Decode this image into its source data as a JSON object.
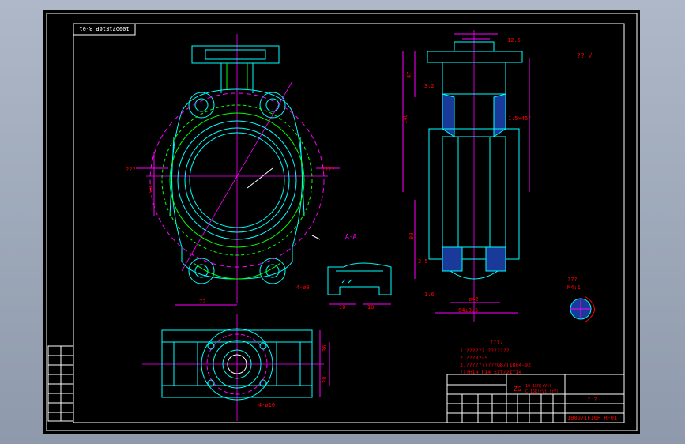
{
  "drawing_number_top": "100D71F16P R-01",
  "drawing_number_block": "100D71F16P R-01",
  "section_label": "A-A",
  "material": "ZG",
  "material_sub1": "10-15R(rVt)",
  "material_sub2": "C-15R(rVt)(rV)",
  "notes_title": "???:",
  "notes": [
    "1.?????? ???????",
    "2.???R2~5",
    "3.??????????GB/T1804-92",
    "  ???H14 h14 ±IT/2IT14"
  ],
  "title_marks": "?   ?",
  "roughness_label": "???",
  "roughness_value": "M4:1",
  "check_mark": "??  √",
  "dims": {
    "d72": "72",
    "d4m8": "4-ø8",
    "d90": "90",
    "d140": "140",
    "d47": "47",
    "d3_2": "3.2",
    "d12_5": "12.5",
    "d15x45": "1.5×45°",
    "d42": "ø42",
    "d64": "64±0.5",
    "d1_6": "1.6",
    "d10a": "10",
    "d10b": "10",
    "d36": "36",
    "d28": "28",
    "d4m10": "4-ø10",
    "d80": "80",
    "d3_5": "3.5",
    "ps1": "???",
    "ps2": "????"
  },
  "colors": {
    "sheet": "#000000",
    "frame": "#ffffff",
    "cyan": "#00ffff",
    "magenta": "#ff00ff",
    "green": "#00ff00",
    "red": "#ff3030",
    "white": "#ffffff"
  }
}
